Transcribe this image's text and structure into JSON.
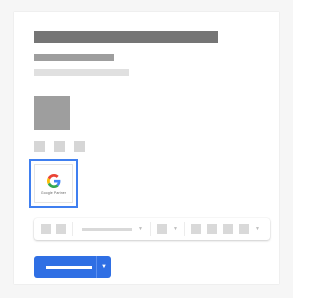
{
  "badge": {
    "logo_letter": "G",
    "caption": "Google Partner"
  },
  "colors": {
    "accent": "#2f6fe4",
    "selection_outline": "#3f7ff0",
    "placeholder_dark": "#757575",
    "placeholder_mid": "#9e9e9e",
    "placeholder_light": "#e0e0e0"
  },
  "icons": {
    "logo": "google-g-icon",
    "dropdown": "caret-down-icon"
  }
}
